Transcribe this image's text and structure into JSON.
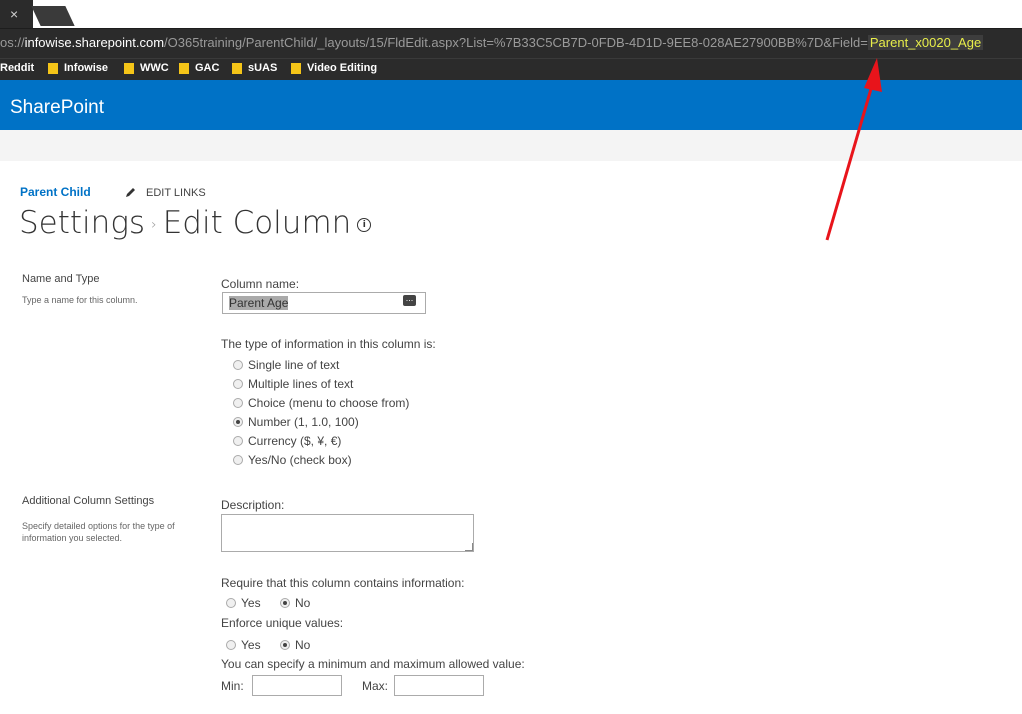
{
  "browser": {
    "tab_close_glyph": "×",
    "url": {
      "prefix": "os://",
      "host": "infowise.sharepoint.com",
      "path": "/O365training/ParentChild/_layouts/15/FldEdit.aspx?List=%7B33C5CB7D-0FDB-4D1D-9EE8-028AE27900BB%7D&Field=",
      "highlight": "Parent_x0020_Age"
    },
    "bookmarks": [
      "Reddit",
      "Infowise",
      "WWC",
      "GAC",
      "sUAS",
      "Video Editing"
    ]
  },
  "suite": {
    "brand": "SharePoint",
    "color": "#0072c6"
  },
  "breadcrumb": {
    "site": "Parent Child",
    "edit_links": "EDIT LINKS"
  },
  "page_title": {
    "part1": "Settings",
    "separator": "›",
    "part2": "Edit Column",
    "info_glyph": "i"
  },
  "name_type": {
    "title": "Name and Type",
    "desc": "Type a name for this column.",
    "column_name_label": "Column name:",
    "column_name_value": "Parent Age",
    "type_label": "The type of information in this column is:",
    "types": [
      {
        "label": "Single line of text",
        "checked": false
      },
      {
        "label": "Multiple lines of text",
        "checked": false
      },
      {
        "label": "Choice (menu to choose from)",
        "checked": false
      },
      {
        "label": "Number (1, 1.0, 100)",
        "checked": true
      },
      {
        "label": "Currency ($, ¥, €)",
        "checked": false
      },
      {
        "label": "Yes/No (check box)",
        "checked": false
      }
    ]
  },
  "additional": {
    "title": "Additional Column Settings",
    "desc": "Specify detailed options for the type of information you selected.",
    "description_label": "Description:",
    "require_label": "Require that this column contains information:",
    "unique_label": "Enforce unique values:",
    "yes": "Yes",
    "no": "No",
    "minmax_label": "You can specify a minimum and maximum allowed value:",
    "min_label": "Min:",
    "max_label": "Max:"
  }
}
